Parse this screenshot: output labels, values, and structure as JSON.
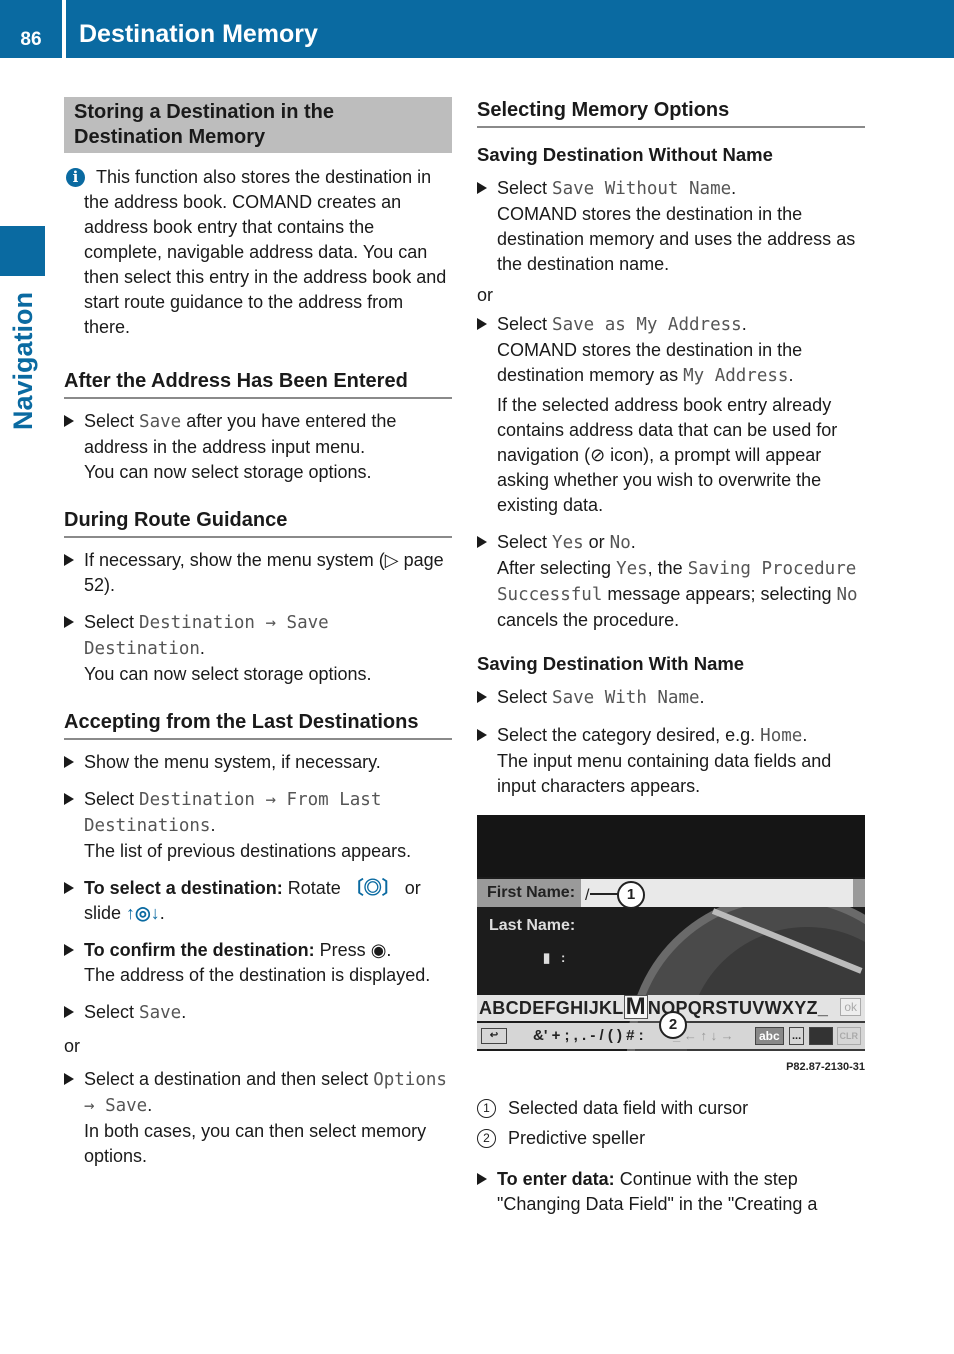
{
  "header": {
    "page_number": "86",
    "title": "Destination Memory"
  },
  "side_tab": {
    "label": "Navigation"
  },
  "left": {
    "box_heading": "Storing a Destination in the Destination Memory",
    "info_icon": "i",
    "info_text": "This function also stores the destination in the address book. COMAND creates an address book entry that contains the complete, navigable address data. You can then select this entry in the address book and start route guidance to the address from there.",
    "sections": [
      {
        "title": "After the Address Has Been Entered",
        "steps": [
          {
            "pre": "Select ",
            "mono": "Save",
            "post": " after you have entered the address in the address input menu.",
            "note": "You can now select storage options."
          }
        ]
      },
      {
        "title": "During Route Guidance",
        "steps": [
          {
            "pre": "If necessary, show the menu system (▷ page 52).",
            "mono": "",
            "post": "",
            "note": ""
          },
          {
            "pre": "Select ",
            "mono": "Destination → Save Destination",
            "post": ".",
            "note": "You can now select storage options."
          }
        ]
      },
      {
        "title": "Accepting from the Last Destinations",
        "steps": [
          {
            "pre": "Show the menu system, if necessary.",
            "mono": "",
            "post": "",
            "note": ""
          },
          {
            "pre": "Select ",
            "mono": "Destination → From Last Destinations",
            "post": ".",
            "note": "The list of previous destinations appears."
          }
        ]
      }
    ],
    "select_step": {
      "bold": "To select a destination:",
      "text1": " Rotate ",
      "rotate_icon": "〔◎〕",
      "text2": " or slide ",
      "slide_icon": "↑◎↓",
      "text3": "."
    },
    "confirm_step": {
      "bold": "To confirm the destination:",
      "text1": " Press ",
      "press_icon": "◉",
      "text2": ".",
      "note": "The address of the destination is displayed."
    },
    "save_step": {
      "pre": "Select ",
      "mono": "Save",
      "post": "."
    },
    "or": "or",
    "alt_step": {
      "pre": "Select a destination and then select ",
      "mono": "Options → Save",
      "post": ".",
      "note": "In both cases, you can then select memory options."
    }
  },
  "right": {
    "heading": "Selecting Memory Options",
    "without_name": {
      "title": "Saving Destination Without Name",
      "step1": {
        "pre": "Select ",
        "mono": "Save Without Name",
        "post": ".",
        "note": "COMAND stores the destination in the destination memory and uses the address as the destination name."
      },
      "or": "or",
      "step2": {
        "pre": "Select ",
        "mono": "Save as My Address",
        "post": ".",
        "note_pre": "COMAND stores the destination in the destination memory as ",
        "note_mono": "My Address",
        "note_post": "."
      },
      "para": {
        "pre": "If the selected address book entry already contains address data that can be used for navigation (",
        "icon": "⊘",
        "post": " icon), a prompt will appear asking whether you wish to overwrite the existing data."
      },
      "step3": {
        "pre": "Select ",
        "yes": "Yes",
        "mid": " or ",
        "no": "No",
        "post": ".",
        "n1": "After selecting ",
        "n_yes": "Yes",
        "n2": ", the ",
        "n_msg": "Saving Procedure Successful",
        "n3": " message appears; selecting ",
        "n_no": "No",
        "n4": " cancels the procedure."
      }
    },
    "with_name": {
      "title": "Saving Destination With Name",
      "step1": {
        "pre": "Select ",
        "mono": "Save With Name",
        "post": "."
      },
      "step2": {
        "pre": "Select the category desired, e.g. ",
        "mono": "Home",
        "post": ".",
        "note": "The input menu containing data fields and input characters appears."
      }
    },
    "screenshot": {
      "field1_label": "First Name:",
      "cursor": "/",
      "field2_label": "Last Name:",
      "keyboard_row1_pre": "ABCDEFGHIJKL",
      "keyboard_selected": "M",
      "keyboard_row1_post": "NOPQRSTUVWXYZ_",
      "ok": "ok",
      "back": "↩",
      "symbols": "&' + ; , . - / ( ) # :",
      "arrows": "_ ← ↑ ↓ →",
      "abc": "abc",
      "dots": "...",
      "clr": "CLR",
      "callout1": "1",
      "callout2": "2",
      "caption": "P82.87-2130-31"
    },
    "legend": [
      {
        "num": "1",
        "text": "Selected data field with cursor"
      },
      {
        "num": "2",
        "text": "Predictive speller"
      }
    ],
    "enter_step": {
      "bold": "To enter data:",
      "text": " Continue with the step \"Changing Data Field\" in the \"Creating a"
    }
  }
}
